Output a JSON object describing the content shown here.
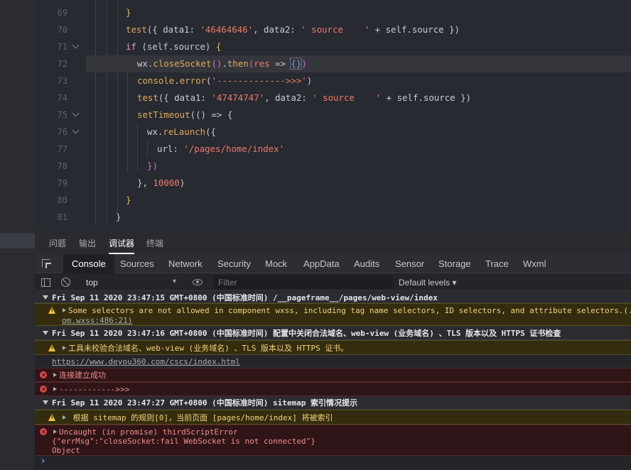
{
  "editor": {
    "lines": [
      {
        "num": "69",
        "parts": [
          [
            "br",
            "}"
          ]
        ]
      },
      {
        "num": "70",
        "parts": [
          [
            "f",
            "test"
          ],
          [
            "v",
            "({ data1: "
          ],
          [
            "s",
            "'46464646'"
          ],
          [
            "v",
            ", data2: "
          ],
          [
            "s",
            "' source    '"
          ],
          [
            "v",
            " + self.source })"
          ]
        ]
      },
      {
        "num": "71",
        "parts": [
          [
            "k",
            "if"
          ],
          [
            "v",
            " (self.source) "
          ],
          [
            "br",
            "{"
          ]
        ]
      },
      {
        "num": "72",
        "parts": [
          [
            "v",
            "wx."
          ],
          [
            "fn",
            "closeSocket"
          ],
          [
            "br2",
            "()"
          ],
          [
            "v",
            "."
          ],
          [
            "fn",
            "then"
          ],
          [
            "br2",
            "("
          ],
          [
            "s",
            "res"
          ],
          [
            "v",
            " => "
          ],
          [
            "br3",
            "{}"
          ],
          [
            "br2",
            ")"
          ]
        ]
      },
      {
        "num": "73",
        "parts": [
          [
            "fn",
            "console"
          ],
          [
            "v",
            "."
          ],
          [
            "fn",
            "error"
          ],
          [
            "v",
            "("
          ],
          [
            "s",
            "'------------->>>'"
          ],
          [
            "v",
            ")"
          ]
        ]
      },
      {
        "num": "74",
        "parts": [
          [
            "f",
            "test"
          ],
          [
            "v",
            "({ data1: "
          ],
          [
            "s",
            "'47474747'"
          ],
          [
            "v",
            ", data2: "
          ],
          [
            "s",
            "' source    '"
          ],
          [
            "v",
            " + self.source })"
          ]
        ]
      },
      {
        "num": "75",
        "parts": [
          [
            "fn",
            "setTimeout"
          ],
          [
            "v",
            "(() => {"
          ]
        ]
      },
      {
        "num": "76",
        "parts": [
          [
            "v",
            "wx."
          ],
          [
            "fn",
            "reLaunch"
          ],
          [
            "v",
            "({"
          ]
        ]
      },
      {
        "num": "77",
        "parts": [
          [
            "v",
            "url: "
          ],
          [
            "s",
            "'/pages/home/index'"
          ]
        ]
      },
      {
        "num": "78",
        "parts": [
          [
            "br2",
            "})"
          ]
        ]
      },
      {
        "num": "79",
        "parts": [
          [
            "v",
            "}, "
          ],
          [
            "n",
            "10000"
          ],
          [
            "v",
            ")"
          ]
        ]
      },
      {
        "num": "80",
        "parts": [
          [
            "br",
            "}"
          ]
        ]
      },
      {
        "num": "81",
        "parts": [
          [
            "v",
            "}"
          ]
        ]
      }
    ]
  },
  "panel_tabs": [
    "问题",
    "输出",
    "调试器",
    "终端"
  ],
  "devtools_tabs": [
    "Console",
    "Sources",
    "Network",
    "Security",
    "Mock",
    "AppData",
    "Audits",
    "Sensor",
    "Storage",
    "Trace",
    "Wxml"
  ],
  "toolbar": {
    "context": "top",
    "filter_placeholder": "Filter",
    "levels": "Default levels ▾"
  },
  "console": {
    "group1": "Fri Sep 11 2020 23:47:15 GMT+0800 (中国标准时间) /__pageframe__/pages/web-view/index",
    "warn1_line1": "Some selectors are not allowed in component wxss, including tag name selectors, ID selectors, and attribute selectors.(./",
    "warn1_line2": "om.wxss:486:21)",
    "group2": "Fri Sep 11 2020 23:47:16 GMT+0800 (中国标准时间) 配置中关闭合法域名、web-view (业务域名) 、TLS 版本以及 HTTPS 证书检查",
    "warn2": "工具未校验合法域名、web-view (业务域名) 、TLS 版本以及 HTTPS 证书。",
    "link": "https://www.deyou360.com/cscs/index.html",
    "err1": "连接建立成功",
    "err2": "------------>>>",
    "group3": "Fri Sep 11 2020 23:47:27 GMT+0800 (中国标准时间) sitemap 索引情况提示",
    "warn3": " 根据 sitemap 的规则[0]，当前页面 [pages/home/index] 将被索引",
    "err3_line1": "Uncaught (in promise) thirdScriptError",
    "err3_line2": "{\"errMsg\":\"closeSocket:fail WebSocket is not connected\"}",
    "err3_line3": "Object"
  },
  "colors": {
    "editor_bg": "#272a30",
    "panel_bg": "#242529",
    "warn_bg": "#332c0e",
    "err_bg": "#2f1517",
    "warn_text": "#f4d37c",
    "err_text": "#f08b8b"
  }
}
